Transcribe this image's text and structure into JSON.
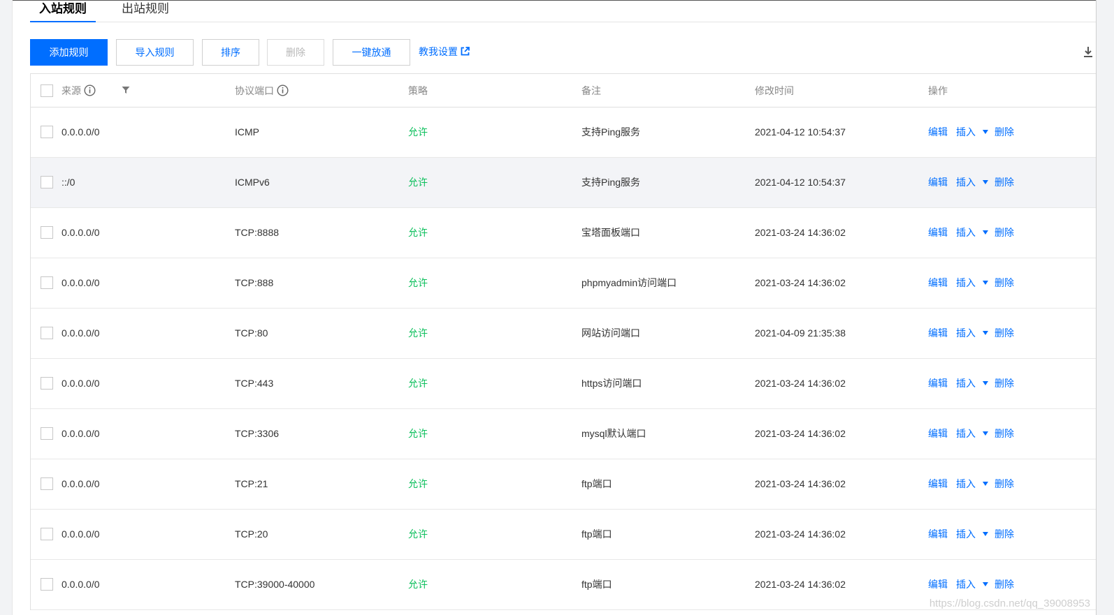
{
  "tabs": [
    {
      "label": "入站规则",
      "active": true
    },
    {
      "label": "出站规则",
      "active": false
    }
  ],
  "toolbar": {
    "add_label": "添加规则",
    "import_label": "导入规则",
    "sort_label": "排序",
    "delete_label": "删除",
    "open_all_label": "一键放通",
    "help_label": "教我设置"
  },
  "icons": {
    "external_link": "external-link-icon",
    "download": "download-icon",
    "info": "info-icon",
    "filter": "filter-icon",
    "caret": "caret-down-icon"
  },
  "colors": {
    "accent": "#006eff",
    "allow": "#0abf5b",
    "disabled": "#b8b8b8"
  },
  "table": {
    "headers": {
      "source": "来源",
      "protocol_port": "协议端口",
      "policy": "策略",
      "note": "备注",
      "modified": "修改时间",
      "actions": "操作"
    },
    "action_labels": {
      "edit": "编辑",
      "insert": "插入",
      "delete": "删除"
    },
    "rows": [
      {
        "source": "0.0.0.0/0",
        "protocol": "ICMP",
        "policy": "允许",
        "note": "支持Ping服务",
        "time": "2021-04-12 10:54:37"
      },
      {
        "source": "::/0",
        "protocol": "ICMPv6",
        "policy": "允许",
        "note": "支持Ping服务",
        "time": "2021-04-12 10:54:37"
      },
      {
        "source": "0.0.0.0/0",
        "protocol": "TCP:8888",
        "policy": "允许",
        "note": "宝塔面板端口",
        "time": "2021-03-24 14:36:02"
      },
      {
        "source": "0.0.0.0/0",
        "protocol": "TCP:888",
        "policy": "允许",
        "note": "phpmyadmin访问端口",
        "time": "2021-03-24 14:36:02"
      },
      {
        "source": "0.0.0.0/0",
        "protocol": "TCP:80",
        "policy": "允许",
        "note": "网站访问端口",
        "time": "2021-04-09 21:35:38"
      },
      {
        "source": "0.0.0.0/0",
        "protocol": "TCP:443",
        "policy": "允许",
        "note": "https访问端口",
        "time": "2021-03-24 14:36:02"
      },
      {
        "source": "0.0.0.0/0",
        "protocol": "TCP:3306",
        "policy": "允许",
        "note": "mysql默认端口",
        "time": "2021-03-24 14:36:02"
      },
      {
        "source": "0.0.0.0/0",
        "protocol": "TCP:21",
        "policy": "允许",
        "note": "ftp端口",
        "time": "2021-03-24 14:36:02"
      },
      {
        "source": "0.0.0.0/0",
        "protocol": "TCP:20",
        "policy": "允许",
        "note": "ftp端口",
        "time": "2021-03-24 14:36:02"
      },
      {
        "source": "0.0.0.0/0",
        "protocol": "TCP:39000-40000",
        "policy": "允许",
        "note": "ftp端口",
        "time": "2021-03-24 14:36:02"
      }
    ]
  },
  "watermark": "https://blog.csdn.net/qq_39008953"
}
